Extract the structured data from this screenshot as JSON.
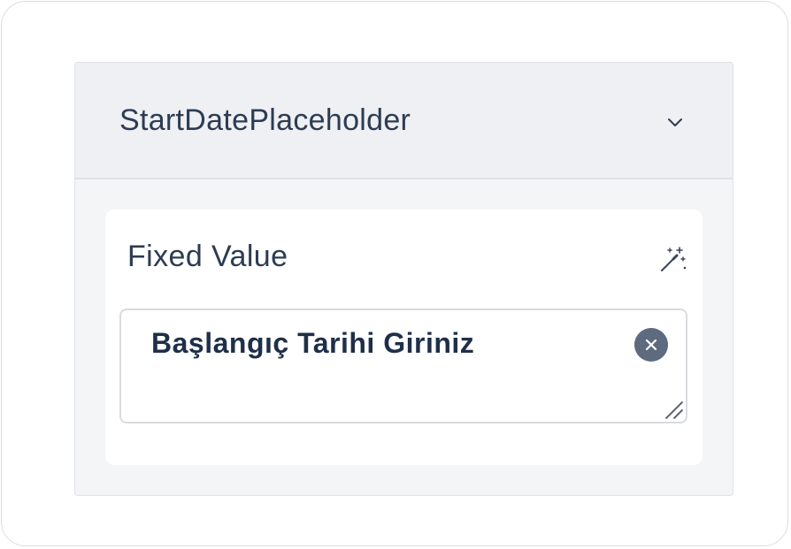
{
  "panel": {
    "title": "StartDatePlaceholder",
    "expand_icon": "chevron-down-icon"
  },
  "field": {
    "label": "Fixed Value",
    "magic_icon": "magic-wand-icon",
    "value": "Başlangıç Tarihi Giriniz",
    "clear_icon": "clear-circle-icon",
    "resize_icon": "resize-handle-icon"
  },
  "colors": {
    "text_primary": "#2d3c52",
    "input_text": "#1f2f49",
    "header_bg": "#eef0f3",
    "panel_bg": "#f4f5f7",
    "clear_button": "#5e6b7f"
  }
}
